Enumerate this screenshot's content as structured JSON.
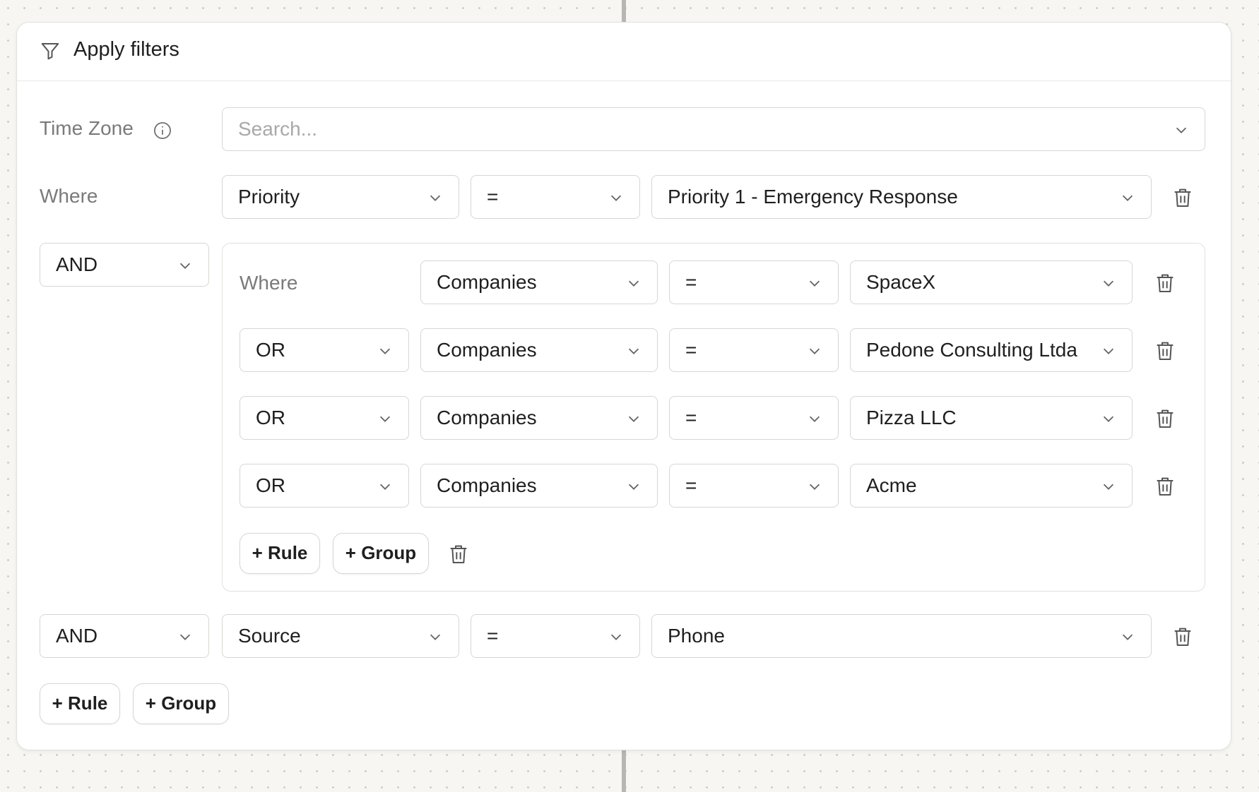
{
  "title": "Apply filters",
  "timezone": {
    "label": "Time Zone",
    "placeholder": "Search..."
  },
  "rule1": {
    "label": "Where",
    "field": "Priority",
    "op": "=",
    "value": "Priority 1 - Emergency Response"
  },
  "group": {
    "combinator": "AND",
    "rows": [
      {
        "prefix": "Where",
        "field": "Companies",
        "op": "=",
        "value": "SpaceX"
      },
      {
        "prefix": "OR",
        "field": "Companies",
        "op": "=",
        "value": "Pedone Consulting Ltda"
      },
      {
        "prefix": "OR",
        "field": "Companies",
        "op": "=",
        "value": "Pizza LLC"
      },
      {
        "prefix": "OR",
        "field": "Companies",
        "op": "=",
        "value": "Acme"
      }
    ],
    "add_rule": "+ Rule",
    "add_group": "+ Group"
  },
  "rule2": {
    "combinator": "AND",
    "field": "Source",
    "op": "=",
    "value": "Phone"
  },
  "footer": {
    "add_rule": "+ Rule",
    "add_group": "+ Group"
  },
  "icons": {
    "filter": "filter-icon",
    "info": "info-icon",
    "chevron": "chevron-down-icon",
    "trash": "trash-icon"
  }
}
